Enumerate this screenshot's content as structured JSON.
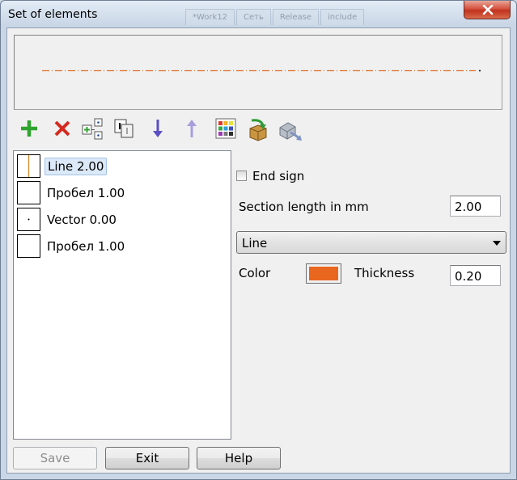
{
  "window": {
    "title": "Set of elements",
    "background_tabs": [
      "*Work12",
      "Сеть",
      "Release",
      "include"
    ]
  },
  "preview": {
    "line_color": "#e0722c"
  },
  "toolbar": {
    "buttons": [
      {
        "name": "add-icon"
      },
      {
        "name": "delete-icon"
      },
      {
        "name": "insert-icon"
      },
      {
        "name": "copy-icon"
      },
      {
        "name": "move-down-icon"
      },
      {
        "name": "move-up-icon"
      },
      {
        "name": "palette-icon"
      },
      {
        "name": "import-icon"
      },
      {
        "name": "export-icon"
      }
    ]
  },
  "elements": [
    {
      "label": "Line 2.00",
      "kind": "line",
      "selected": true
    },
    {
      "label": "Пробел 1.00",
      "kind": "space",
      "selected": false
    },
    {
      "label": "Vector 0.00",
      "kind": "vector",
      "selected": false
    },
    {
      "label": "Пробел 1.00",
      "kind": "space",
      "selected": false
    }
  ],
  "properties": {
    "end_sign_label": "End sign",
    "end_sign_checked": false,
    "section_length_label": "Section length in mm",
    "section_length_value": "2.00",
    "type_value": "Line",
    "color_label": "Color",
    "color_value": "#e8661e",
    "thickness_label": "Thickness",
    "thickness_value": "0.20"
  },
  "buttons": {
    "save": "Save",
    "exit": "Exit",
    "help": "Help"
  }
}
